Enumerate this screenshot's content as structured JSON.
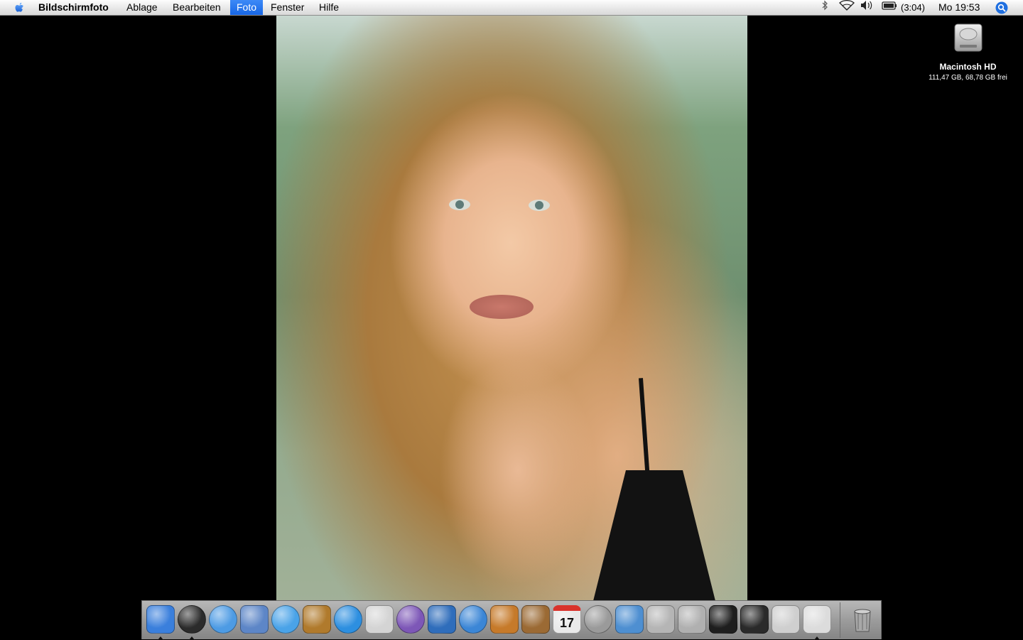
{
  "menubar": {
    "apple_icon": "apple-logo-icon",
    "app_name": "Bildschirmfoto",
    "items": [
      "Ablage",
      "Bearbeiten",
      "Foto",
      "Fenster",
      "Hilfe"
    ],
    "active_item": "Foto",
    "status": {
      "icons": [
        "bluetooth-icon",
        "wifi-icon",
        "volume-icon",
        "battery-icon",
        "spotlight-icon"
      ],
      "battery_time": "(3:04)",
      "clock": "Mo 19:53"
    }
  },
  "desktop": {
    "hd_icon": {
      "icon": "hard-drive-icon",
      "name": "Macintosh HD",
      "info": "111,47 GB, 68,78 GB frei"
    }
  },
  "photo": {
    "description_icon": "portrait-photo"
  },
  "dock": {
    "items": [
      {
        "icon": "finder-icon",
        "running": true,
        "color": "#3a7fdc"
      },
      {
        "icon": "dashboard-icon",
        "running": true,
        "color": "#2b2b2b"
      },
      {
        "icon": "safari-icon",
        "running": false,
        "color": "#4d9be4"
      },
      {
        "icon": "mail-icon",
        "running": false,
        "color": "#5d86c7"
      },
      {
        "icon": "itunes-icon",
        "running": false,
        "color": "#4aa3e8"
      },
      {
        "icon": "iphoto-icon",
        "running": false,
        "color": "#b07a2c"
      },
      {
        "icon": "quicktime-icon",
        "running": false,
        "color": "#2d8fe0"
      },
      {
        "icon": "dvd-player-icon",
        "running": false,
        "color": "#d4d4d4"
      },
      {
        "icon": "itunes-cd-icon",
        "running": false,
        "color": "#7d57b7"
      },
      {
        "icon": "imovie-icon",
        "running": false,
        "color": "#2f6dbb"
      },
      {
        "icon": "idvd-icon",
        "running": false,
        "color": "#3b86d6"
      },
      {
        "icon": "garageband-icon",
        "running": false,
        "color": "#c67a2a"
      },
      {
        "icon": "address-book-icon",
        "running": false,
        "color": "#9b6a34"
      },
      {
        "icon": "ical-icon",
        "running": false,
        "color": "#e9e9e9",
        "label": "17"
      },
      {
        "icon": "sync-icon",
        "running": false,
        "color": "#9a9a9a"
      },
      {
        "icon": "network-icon",
        "running": false,
        "color": "#4e8fd1"
      },
      {
        "icon": "installer-icon",
        "running": false,
        "color": "#b5b5b5"
      },
      {
        "icon": "utility-icon",
        "running": false,
        "color": "#b0b0b0"
      },
      {
        "icon": "terminal-icon",
        "running": false,
        "color": "#1e1e1e"
      },
      {
        "icon": "activity-monitor-icon",
        "running": false,
        "color": "#2a2a2a"
      },
      {
        "icon": "system-profiler-icon",
        "running": false,
        "color": "#cfcfcf"
      },
      {
        "icon": "grab-icon",
        "running": true,
        "color": "#dcdcdc"
      }
    ],
    "trash": {
      "icon": "trash-icon",
      "color": "#8f8f8f"
    }
  }
}
